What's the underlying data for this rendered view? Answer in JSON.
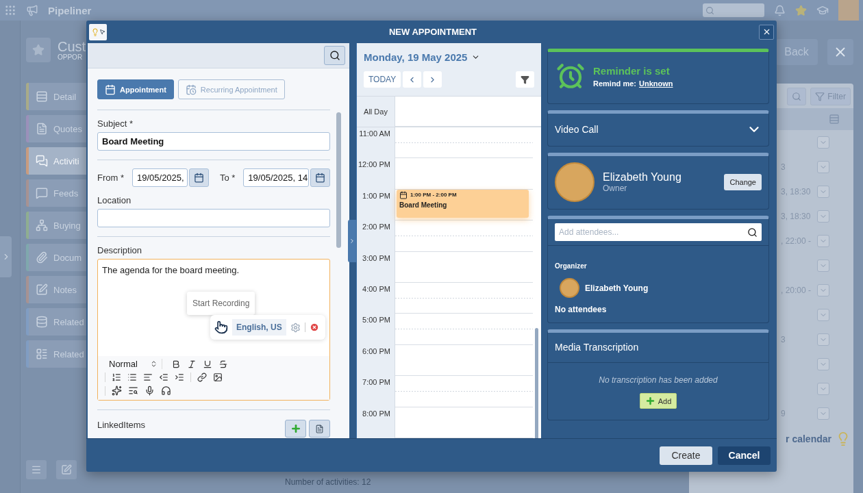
{
  "app": {
    "brand": "Pipeliner",
    "record_title": "Cust",
    "record_subtitle": "OPPOR",
    "nav": [
      {
        "label": "Detail",
        "color": "#a9ab88",
        "selected": false
      },
      {
        "label": "Quotes",
        "color": "#9b90ba",
        "selected": false
      },
      {
        "label": "Activiti",
        "color": "#c99c7f",
        "selected": true
      },
      {
        "label": "Feeds",
        "color": "#a79292",
        "selected": false
      },
      {
        "label": "Buying",
        "color": "#8fae90",
        "selected": false
      },
      {
        "label": "Docum",
        "color": "#7fa8ad",
        "selected": false
      },
      {
        "label": "Notes",
        "color": "#a79292",
        "selected": false
      },
      {
        "label": "Related",
        "color": "#809dc2",
        "selected": false
      },
      {
        "label": "Related",
        "color": "#809dc2",
        "selected": false
      }
    ],
    "back": "Back",
    "filter": "Filter",
    "rows": [
      {},
      {
        "fragment": "3"
      },
      {
        "fragment": "3, 18:30"
      },
      {
        "fragment": "3, 18:30"
      },
      {
        "fragment": ", 22:00 -"
      },
      {},
      {
        "fragment": ", 20:00 -"
      },
      {},
      {
        "fragment": "3"
      },
      {},
      {},
      {
        "fragment": "9"
      }
    ],
    "calendar_link": "r calendar",
    "footer": "Number of activities: 12"
  },
  "dialog": {
    "title": "NEW APPOINTMENT",
    "type_tabs": [
      {
        "label": "Appointment",
        "selected": true
      },
      {
        "label": "Recurring Appointment",
        "selected": false
      }
    ],
    "subject": {
      "label": "Subject *",
      "value": "Board Meeting"
    },
    "from": {
      "label": "From *",
      "value": "19/05/2025,"
    },
    "to": {
      "label": "To *",
      "value": "19/05/2025, 14"
    },
    "location": {
      "label": "Location"
    },
    "description": {
      "label": "Description",
      "value": "The agenda for the board meeting.",
      "tooltip": "Start Recording",
      "language": "English, US",
      "format": "Normal"
    },
    "linked_items": {
      "label": "LinkedItems"
    },
    "calendar": {
      "date": "Monday, 19 May 2025",
      "today": "TODAY",
      "all_day": "All Day",
      "hours": [
        {
          "label": "11:00 AM"
        },
        {
          "label": "12:00 PM"
        },
        {
          "label": "1:00 PM",
          "event": {
            "time": "1:00 PM - 2:00 PM",
            "title": "Board Meeting"
          }
        },
        {
          "label": "2:00 PM"
        },
        {
          "label": "3:00 PM"
        },
        {
          "label": "4:00 PM"
        },
        {
          "label": "5:00 PM"
        },
        {
          "label": "6:00 PM"
        },
        {
          "label": "7:00 PM"
        },
        {
          "label": "8:00 PM"
        }
      ]
    },
    "reminder": {
      "title": "Reminder is set",
      "label": "Remind me:",
      "value": "Unknown"
    },
    "video_call": {
      "title": "Video Call",
      "expanded": false
    },
    "owner": {
      "name": "Elizabeth Young",
      "role": "Owner",
      "button": "Change"
    },
    "attendees": {
      "placeholder": "Add attendees...",
      "organizer_label": "Organizer",
      "organizer": "Elizabeth Young",
      "empty": "No attendees"
    },
    "transcription": {
      "title": "Media Transcription",
      "empty": "No transcription has been added",
      "button": "Add"
    },
    "buttons": [
      {
        "label": "Create",
        "kind": "secondary"
      },
      {
        "label": "Cancel",
        "kind": "primary"
      }
    ]
  }
}
